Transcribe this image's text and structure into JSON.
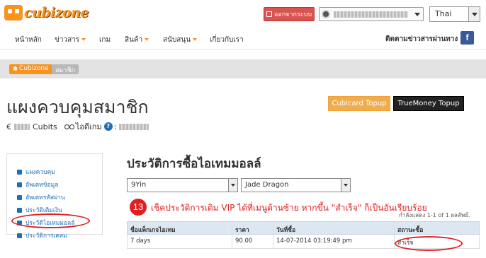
{
  "header": {
    "logo_text": "cubizone",
    "logout_label": "ออกจากระบบ",
    "language": "Thai"
  },
  "nav": {
    "items": [
      {
        "label": "หน้าหลัก",
        "dropdown": false
      },
      {
        "label": "ข่าวสาร",
        "dropdown": true
      },
      {
        "label": "เกม",
        "dropdown": false
      },
      {
        "label": "สินค้า",
        "dropdown": true
      },
      {
        "label": "สนับสนุน",
        "dropdown": true
      },
      {
        "label": "เกี่ยวกับเรา",
        "dropdown": false
      }
    ],
    "follow_text": "ติดตามข่าวสารผ่านทาง",
    "facebook_letter": "f"
  },
  "breadcrumb": {
    "home": "Cubizone",
    "current": "สมาชิก"
  },
  "page": {
    "title": "แผงควบคุมสมาชิก",
    "currency_symbol": "€",
    "cubits_label": "Cubits",
    "game_id_label": "ไอดีเกม",
    "help_glyph": "?",
    "separator": ":"
  },
  "buttons": {
    "cubicard": "Cubicard Topup",
    "truemoney": "TrueMoney Topup"
  },
  "sidebar": {
    "items": [
      {
        "label": "แผงควบคุม",
        "icon": "home-icon"
      },
      {
        "label": "อัพเดทข้อมูล",
        "icon": "edit-icon"
      },
      {
        "label": "อัพเดทรหัสผ่าน",
        "icon": "key-icon"
      },
      {
        "label": "ประวัติเติมเงิน",
        "icon": "calendar-icon"
      },
      {
        "label": "ประวัติไอเทมมอลล์",
        "icon": "cart-icon"
      },
      {
        "label": "ประวัติการเคลม",
        "icon": "gift-icon"
      }
    ]
  },
  "main": {
    "section_title": "ประวัติการซื้อไอเทมมอลล์",
    "game_select": "9Yin",
    "server_select": "Jade Dragon",
    "step_number": "13",
    "instruction": "เช็คประวัติการเติม VIP ได้ที่เมนูด้านซ้าย หากขึ้น \"สำเร็จ\" ก็เป็นอันเรียบร้อย",
    "showing": "กำลังแสดง 1-1 of 1 ผลลัพธ์.",
    "table": {
      "headers": [
        "ชื่อแพ็กเกจไอเทม",
        "ราคา",
        "วันที่ซื้อ",
        "สถานะซื้อ"
      ],
      "rows": [
        [
          "7 days",
          "90.00",
          "14-07-2014 03:19:49 pm",
          "สำเร็จ"
        ]
      ]
    }
  },
  "colors": {
    "accent": "#f7931e",
    "danger": "#d9534f",
    "annotation": "#e02020",
    "link": "#1f6fb5"
  }
}
